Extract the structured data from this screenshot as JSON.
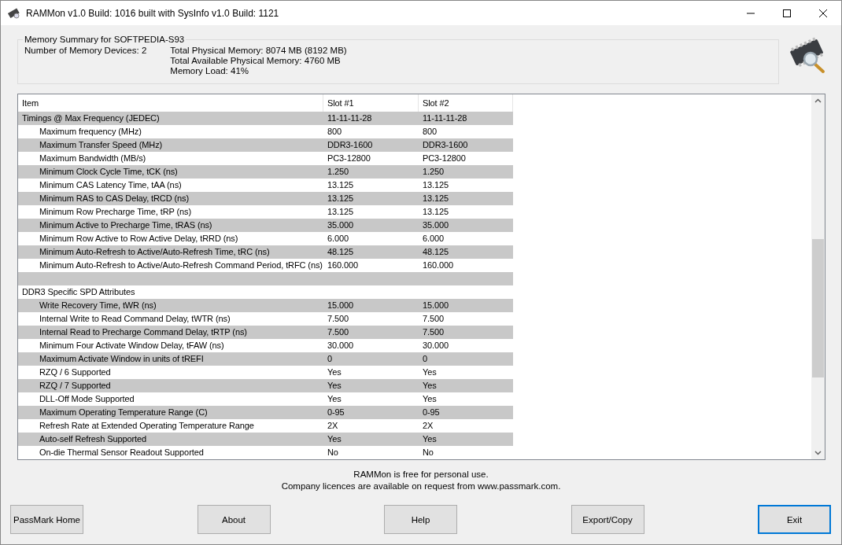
{
  "window": {
    "title": "RAMMon v1.0 Build: 1016 built with SysInfo v1.0 Build: 1121"
  },
  "summary": {
    "title": "Memory Summary for SOFTPEDIA-S93",
    "devices": "Number of Memory Devices: 2",
    "lines": [
      "Total Physical Memory: 8074 MB (8192 MB)",
      "Total Available Physical Memory: 4760 MB",
      "Memory Load: 41%"
    ]
  },
  "table": {
    "columns": [
      "Item",
      "Slot #1",
      "Slot #2"
    ],
    "rows": [
      {
        "kind": "group",
        "cells": [
          "Timings @ Max Frequency (JEDEC)",
          "11-11-11-28",
          "11-11-11-28"
        ]
      },
      {
        "kind": "item",
        "cells": [
          "Maximum frequency (MHz)",
          "800",
          "800"
        ]
      },
      {
        "kind": "item",
        "cells": [
          "Maximum Transfer Speed (MHz)",
          "DDR3-1600",
          "DDR3-1600"
        ]
      },
      {
        "kind": "item",
        "cells": [
          "Maximum Bandwidth (MB/s)",
          "PC3-12800",
          "PC3-12800"
        ]
      },
      {
        "kind": "item",
        "cells": [
          "Minimum Clock Cycle Time, tCK (ns)",
          "1.250",
          "1.250"
        ]
      },
      {
        "kind": "item",
        "cells": [
          "Minimum CAS Latency Time, tAA (ns)",
          "13.125",
          "13.125"
        ]
      },
      {
        "kind": "item",
        "cells": [
          "Minimum RAS to CAS Delay, tRCD (ns)",
          "13.125",
          "13.125"
        ]
      },
      {
        "kind": "item",
        "cells": [
          "Minimum Row Precharge Time, tRP (ns)",
          "13.125",
          "13.125"
        ]
      },
      {
        "kind": "item",
        "cells": [
          "Minimum Active to Precharge Time, tRAS (ns)",
          "35.000",
          "35.000"
        ]
      },
      {
        "kind": "item",
        "cells": [
          "Minimum Row Active to Row Active Delay, tRRD (ns)",
          "6.000",
          "6.000"
        ]
      },
      {
        "kind": "item",
        "cells": [
          "Minimum Auto-Refresh to Active/Auto-Refresh Time, tRC (ns)",
          "48.125",
          "48.125"
        ]
      },
      {
        "kind": "item",
        "cells": [
          "Minimum Auto-Refresh to Active/Auto-Refresh Command Period, tRFC (ns)",
          "160.000",
          "160.000"
        ]
      },
      {
        "kind": "blank",
        "cells": []
      },
      {
        "kind": "group",
        "cells": [
          "DDR3 Specific SPD Attributes"
        ]
      },
      {
        "kind": "item",
        "cells": [
          "Write Recovery Time, tWR (ns)",
          "15.000",
          "15.000"
        ]
      },
      {
        "kind": "item",
        "cells": [
          "Internal Write to Read Command Delay, tWTR (ns)",
          "7.500",
          "7.500"
        ]
      },
      {
        "kind": "item",
        "cells": [
          "Internal Read to Precharge Command Delay, tRTP (ns)",
          "7.500",
          "7.500"
        ]
      },
      {
        "kind": "item",
        "cells": [
          "Minimum Four Activate Window Delay, tFAW (ns)",
          "30.000",
          "30.000"
        ]
      },
      {
        "kind": "item",
        "cells": [
          "Maximum Activate Window in units of tREFI",
          "0",
          "0"
        ]
      },
      {
        "kind": "item",
        "cells": [
          "RZQ / 6 Supported",
          "Yes",
          "Yes"
        ]
      },
      {
        "kind": "item",
        "cells": [
          "RZQ / 7 Supported",
          "Yes",
          "Yes"
        ]
      },
      {
        "kind": "item",
        "cells": [
          "DLL-Off Mode Supported",
          "Yes",
          "Yes"
        ]
      },
      {
        "kind": "item",
        "cells": [
          "Maximum Operating Temperature Range (C)",
          "0-95",
          "0-95"
        ]
      },
      {
        "kind": "item",
        "cells": [
          "Refresh Rate at Extended Operating Temperature Range",
          "2X",
          "2X"
        ]
      },
      {
        "kind": "item",
        "cells": [
          "Auto-self Refresh Supported",
          "Yes",
          "Yes"
        ]
      },
      {
        "kind": "item",
        "cells": [
          "On-die Thermal Sensor Readout Supported",
          "No",
          "No"
        ]
      }
    ]
  },
  "footer": {
    "lines": [
      "RAMMon is free for personal use.",
      "Company licences are available on request from www.passmark.com."
    ]
  },
  "buttons": [
    {
      "label": "PassMark Home",
      "default": false
    },
    {
      "label": "About",
      "default": false
    },
    {
      "label": "Help",
      "default": false
    },
    {
      "label": "Export/Copy",
      "default": false
    },
    {
      "label": "Exit",
      "default": true
    }
  ]
}
